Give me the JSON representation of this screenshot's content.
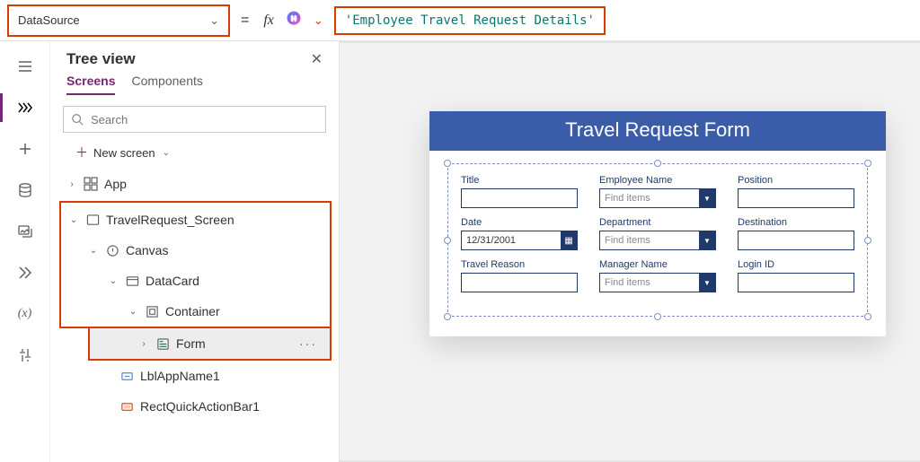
{
  "formula_bar": {
    "property": "DataSource",
    "value": "'Employee Travel Request Details'"
  },
  "panel": {
    "title": "Tree view",
    "tabs": {
      "screens": "Screens",
      "components": "Components"
    },
    "search_placeholder": "Search",
    "new_screen": "New screen",
    "tree": {
      "app": "App",
      "screen": "TravelRequest_Screen",
      "canvas": "Canvas",
      "datacard": "DataCard",
      "container": "Container",
      "form": "Form",
      "lbl": "LblAppName1",
      "rect": "RectQuickActionBar1"
    }
  },
  "canvas": {
    "title": "Travel Request Form",
    "fields": {
      "title": "Title",
      "employee_name": "Employee Name",
      "position": "Position",
      "date": "Date",
      "department": "Department",
      "destination": "Destination",
      "travel_reason": "Travel Reason",
      "manager_name": "Manager Name",
      "login_id": "Login ID"
    },
    "values": {
      "date": "12/31/2001",
      "find_items": "Find items"
    }
  }
}
